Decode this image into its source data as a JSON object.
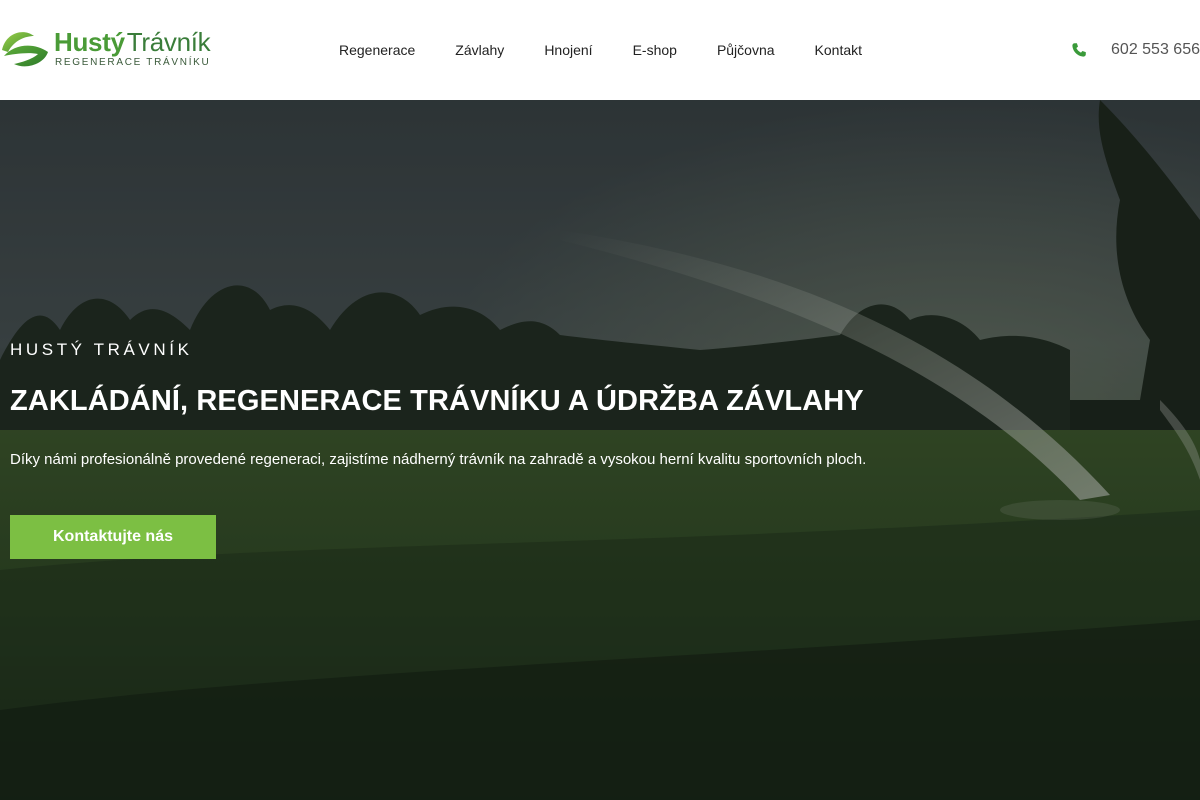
{
  "brand": {
    "name_part1": "Hustý",
    "name_part2": "Trávník",
    "tagline": "REGENERACE TRÁVNÍKU"
  },
  "nav": {
    "items": [
      {
        "label": "Regenerace"
      },
      {
        "label": "Závlahy"
      },
      {
        "label": "Hnojení"
      },
      {
        "label": "E-shop"
      },
      {
        "label": "Půjčovna"
      },
      {
        "label": "Kontakt"
      }
    ]
  },
  "contact": {
    "phone": "602 553 656",
    "icon": "phone-icon"
  },
  "hero": {
    "kicker": "HUSTÝ TRÁVNÍK",
    "title": "ZAKLÁDÁNÍ, REGENERACE TRÁVNÍKU A ÚDRŽBA ZÁVLAHY",
    "text": "Díky námi profesionálně provedené regeneraci, zajistíme nádherný trávník na zahradě a vysokou herní kvalitu sportovních ploch.",
    "cta_label": "Kontaktujte nás"
  },
  "colors": {
    "accent": "#7cbf43",
    "logo_green": "#4a9b37",
    "phone_icon": "#3a9a3a",
    "nav_text": "#222222"
  }
}
